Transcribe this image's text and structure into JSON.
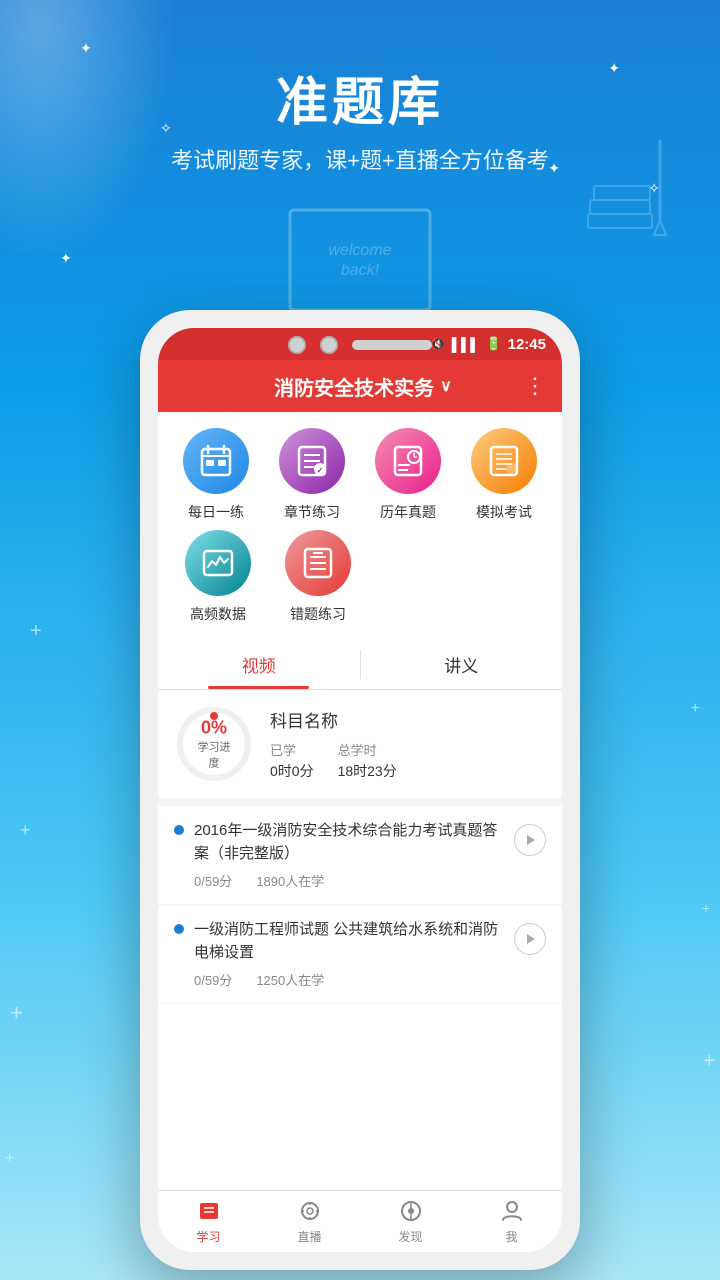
{
  "app": {
    "title": "准题库",
    "subtitle": "考试刷题专家，课+题+直播全方位备考"
  },
  "status_bar": {
    "mute": "✕",
    "signal": "📶",
    "battery": "🔋",
    "time": "12:45"
  },
  "header": {
    "title": "消防安全技术实务",
    "dropdown_icon": "∨",
    "menu_icon": "⋮"
  },
  "icons": [
    {
      "id": "daily",
      "label": "每日一练",
      "color_class": "ic-blue"
    },
    {
      "id": "chapter",
      "label": "章节练习",
      "color_class": "ic-purple"
    },
    {
      "id": "past",
      "label": "历年真题",
      "color_class": "ic-pink"
    },
    {
      "id": "mock",
      "label": "模拟考试",
      "color_class": "ic-orange"
    },
    {
      "id": "freq",
      "label": "高频数据",
      "color_class": "ic-teal"
    },
    {
      "id": "wrong",
      "label": "错题练习",
      "color_class": "ic-red"
    }
  ],
  "tabs": {
    "video": "视频",
    "notes": "讲义"
  },
  "progress": {
    "percent": "0%",
    "label": "学习进度",
    "subject": "科目名称",
    "studied_label": "已学",
    "studied_value": "0时0分",
    "total_label": "总学时",
    "total_value": "18时23分"
  },
  "videos": [
    {
      "title": "2016年一级消防安全技术综合能力考试真题答案（非完整版）",
      "score": "0/59分",
      "students": "1890人在学"
    },
    {
      "title": "一级消防工程师试题 公共建筑给水系统和消防电梯设置",
      "score": "0/59分",
      "students": "1250人在学"
    }
  ],
  "bottom_nav": [
    {
      "id": "study",
      "label": "学习",
      "active": true
    },
    {
      "id": "live",
      "label": "直播",
      "active": false
    },
    {
      "id": "discover",
      "label": "发现",
      "active": false
    },
    {
      "id": "profile",
      "label": "我",
      "active": false
    }
  ],
  "welcome": "Welcome back"
}
